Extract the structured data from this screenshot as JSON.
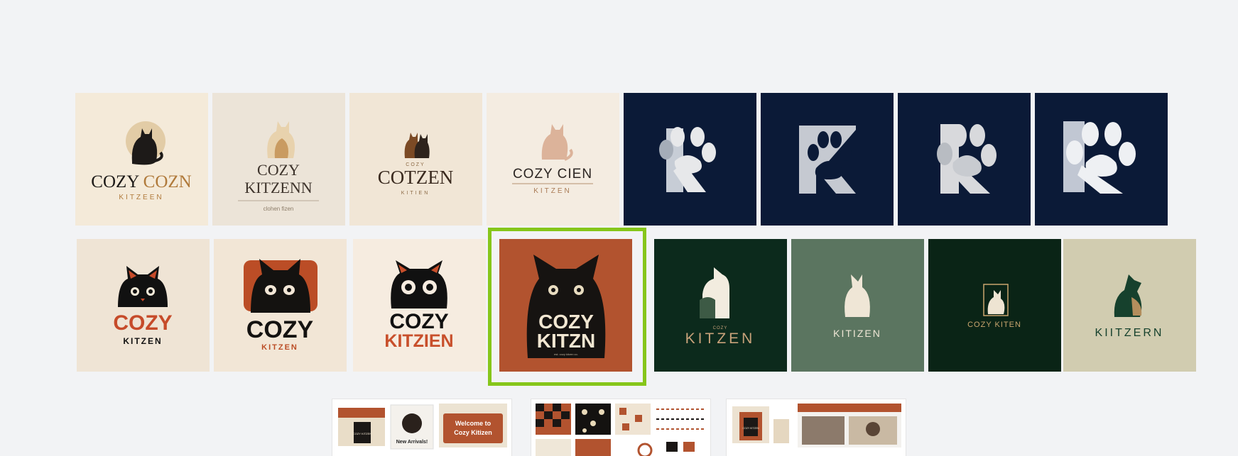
{
  "colors": {
    "background": "#f2f3f5",
    "selection": "#86c61a",
    "navy": "#0c1a36",
    "rust": "#b2532f",
    "forest": "#0c2a1c",
    "sage": "#5b7560",
    "cream": "#f1e8dc"
  },
  "row1": [
    {
      "name": "cozy-cozn-logo",
      "line1": "COZY",
      "line2": "COZN",
      "line3": "KITZEEN"
    },
    {
      "name": "cozy-kitzenn-logo",
      "line1": "COZY",
      "line2": "KITZENN",
      "line3": "clohen fizen"
    },
    {
      "name": "cotzen-logo",
      "line1": "COZY",
      "line2": "COTZEN",
      "line3": "KITIEN"
    },
    {
      "name": "cozy-cien-logo",
      "line1": "COZY CIEN",
      "line2": "KITZEN"
    },
    {
      "name": "paw-k-logo-1"
    },
    {
      "name": "paw-k-logo-2"
    },
    {
      "name": "paw-k-logo-3"
    },
    {
      "name": "paw-k-logo-4"
    }
  ],
  "row2": [
    {
      "name": "cozy-kitzen-cat-logo",
      "line1": "COZY",
      "line2": "KITZEN"
    },
    {
      "name": "cozy-kitzen-bold-logo",
      "line1": "COZY",
      "line2": "KITZEN"
    },
    {
      "name": "cozy-kitzien-logo",
      "line1": "COZY",
      "line2": "KITZIEN"
    },
    {
      "name": "cozy-kitzn-logo-selected",
      "line1": "COZY",
      "line2": "KITZN",
      "line3": "est. cozy kitzen co."
    },
    {
      "name": "kitzen-forest-logo",
      "line1": "COZY",
      "line2": "KITZEN"
    },
    {
      "name": "kitzen-sage-logo",
      "line1": "KITIZEN"
    },
    {
      "name": "cozy-kiten-logo",
      "line1": "COZY KITEN"
    },
    {
      "name": "kiitzern-logo",
      "line1": "KIITZERN"
    }
  ],
  "previews": [
    {
      "name": "brand-mockup-preview",
      "title": "Welcome to",
      "title2": "Cozy Kitizen",
      "tag": "New Arrivals!",
      "box": "COZY KITZEN"
    },
    {
      "name": "pattern-sheet-preview"
    },
    {
      "name": "storefront-mockup-preview",
      "box": "COZY KITZEN"
    }
  ]
}
